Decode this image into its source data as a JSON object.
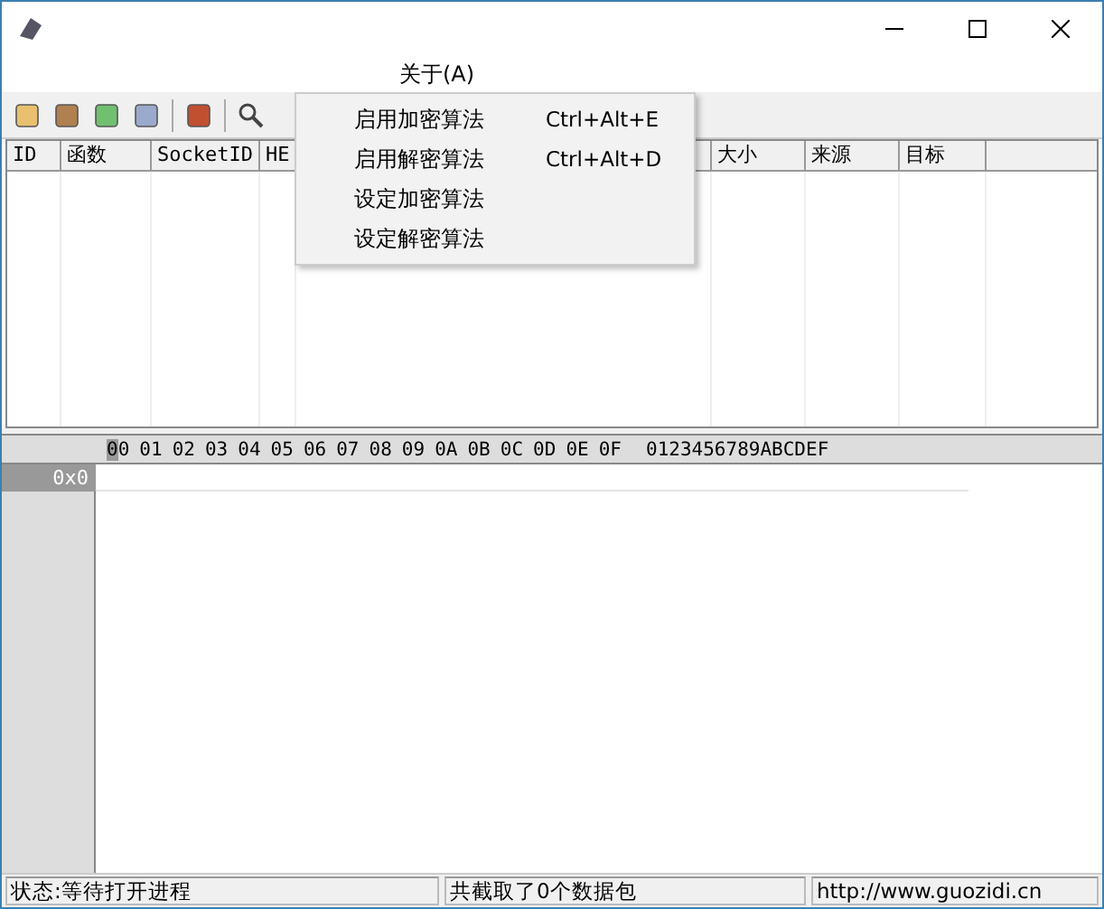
{
  "menu_bar": [
    {
      "label": "关于(A)"
    }
  ],
  "dropdown_menu": [
    {
      "label": "启用加密算法",
      "shortcut": "Ctrl+Alt+E"
    },
    {
      "label": "启用解密算法",
      "shortcut": "Ctrl+Alt+D"
    },
    {
      "label": "设定加密算法"
    },
    {
      "label": "设定解密算法"
    }
  ],
  "packet_table": {
    "columns": [
      "ID",
      "函数",
      "SocketID",
      "HE",
      "大小",
      "来源",
      "目标"
    ]
  },
  "hex_view": {
    "header": [
      "00",
      "01",
      "02",
      "03",
      "04",
      "05",
      "06",
      "07",
      "08",
      "09",
      "0A",
      "0B",
      "0C",
      "0D",
      "0E",
      "0F"
    ],
    "ascii_header": "0123456789ABCDEF",
    "rows": [
      {
        "offset": "0x0"
      }
    ]
  },
  "status_bar": [
    "状态:等待打开进程",
    "共截取了0个数据包",
    "http://www.guozidi.cn"
  ]
}
